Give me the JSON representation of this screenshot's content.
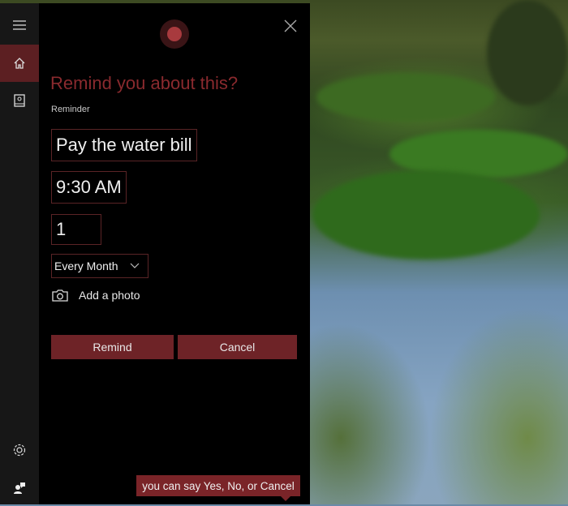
{
  "colors": {
    "accent": "#8a2a2e",
    "button": "#6e2327",
    "sidebar_active": "#5c1f22"
  },
  "sidebar": {
    "items": [
      {
        "icon": "menu-icon"
      },
      {
        "icon": "home-icon",
        "active": true
      },
      {
        "icon": "notebook-icon"
      },
      {
        "icon": "gear-icon"
      },
      {
        "icon": "feedback-icon"
      }
    ]
  },
  "panel": {
    "title": "Remind you about this?",
    "reminder_label": "Reminder",
    "reminder_text": "Pay the water bill",
    "time": "9:30 AM",
    "day": "1",
    "repeat": "Every Month",
    "add_photo": "Add a photo",
    "remind_label": "Remind",
    "cancel_label": "Cancel"
  },
  "tooltip": "you can say Yes, No, or Cancel"
}
